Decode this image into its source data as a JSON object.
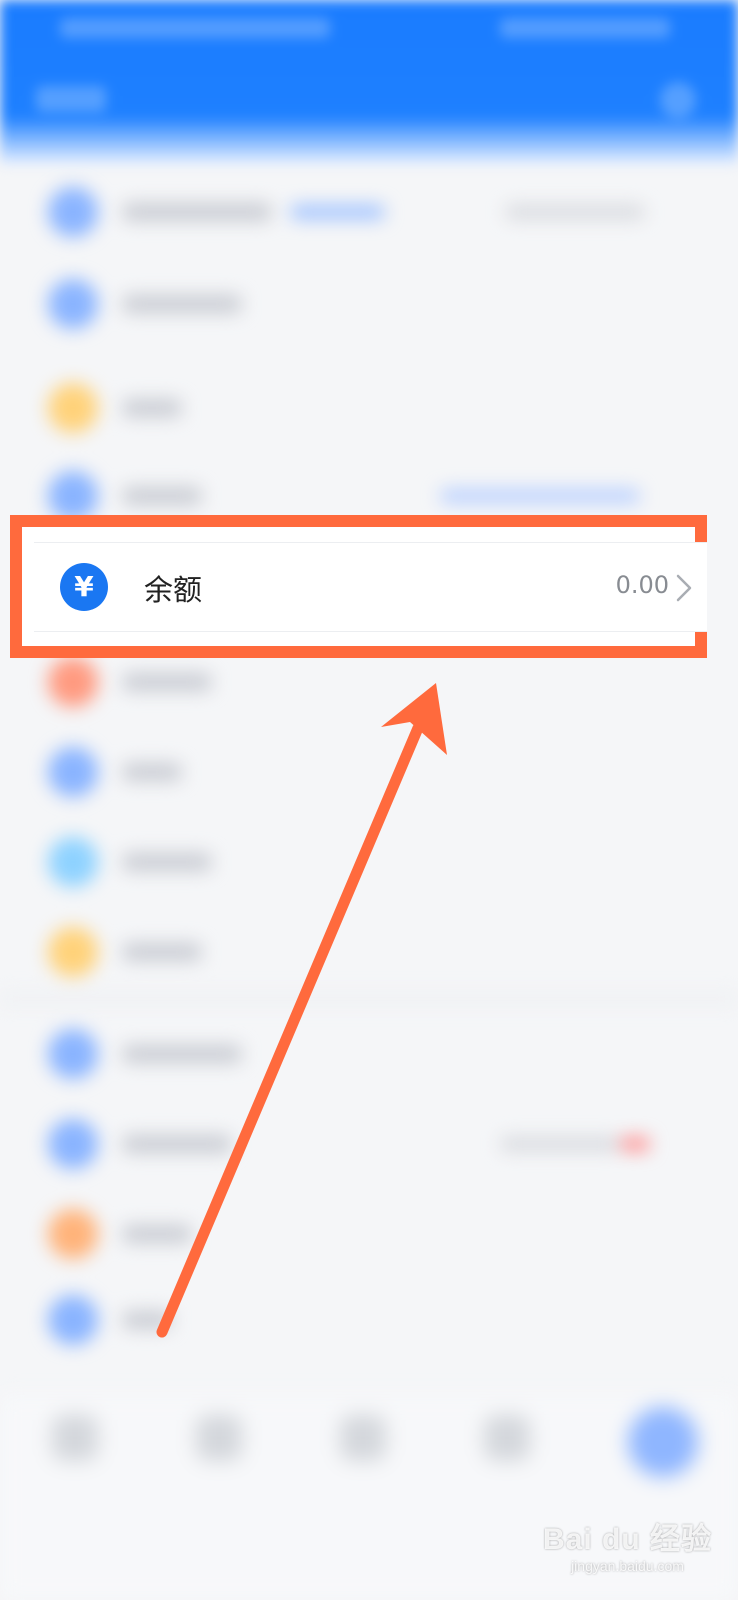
{
  "balance_item": {
    "icon": "yen-icon",
    "icon_glyph": "¥",
    "label": "余额",
    "value": "0.00"
  },
  "watermark": {
    "main": "Bai du 经验",
    "sub": "jingyan.baidu.com"
  },
  "colors": {
    "header_blue": "#1a7cff",
    "icon_blue": "#1a77f2",
    "highlight_orange": "#ff6a3d"
  }
}
